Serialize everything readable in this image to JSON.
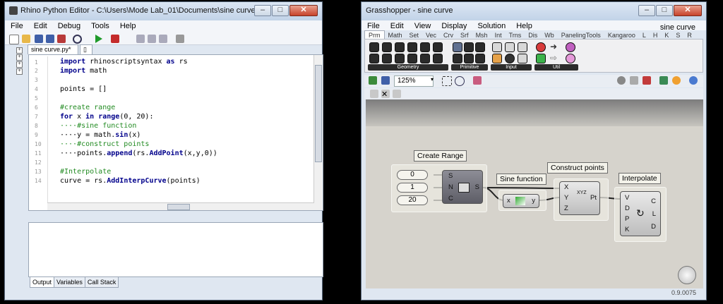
{
  "rhino": {
    "title": "Rhino Python Editor - C:\\Users\\Mode Lab_01\\Documents\\sine curve.py",
    "menu": [
      "File",
      "Edit",
      "Debug",
      "Tools",
      "Help"
    ],
    "tab": "sine curve.py*",
    "line_numbers": [
      "1",
      "2",
      "3",
      "4",
      "5",
      "6",
      "7",
      "8",
      "9",
      "10",
      "11",
      "12",
      "13",
      "14"
    ],
    "code": {
      "l1_kw": "import",
      "l1_rest": " rhinoscriptsyntax ",
      "l1_kw2": "as",
      "l1_rest2": " rs",
      "l2_kw": "import",
      "l2_rest": " math",
      "l4": "points = []",
      "l6": "#create range",
      "l7_kw": "for",
      "l7_a": " x ",
      "l7_kw2": "in",
      "l7_b": " ",
      "l7_kw3": "range",
      "l7_c": "(0, 20):",
      "l8": "····#sine function",
      "l9_a": "····y = math.",
      "l9_kw": "sin",
      "l9_b": "(x)",
      "l10": "····#construct points",
      "l11_a": "····points.",
      "l11_kw": "append",
      "l11_b": "(rs.",
      "l11_kw2": "AddPoint",
      "l11_c": "(x,y,0))",
      "l13": "#Interpolate",
      "l14_a": "curve = rs.",
      "l14_kw": "AddInterpCurve",
      "l14_b": "(points)"
    },
    "bottom_tabs": [
      "Output",
      "Variables",
      "Call Stack"
    ]
  },
  "gh": {
    "title": "Grasshopper - sine curve",
    "menu": [
      "File",
      "Edit",
      "View",
      "Display",
      "Solution",
      "Help"
    ],
    "doc_name": "sine curve",
    "tabs": [
      "Prm",
      "Math",
      "Set",
      "Vec",
      "Crv",
      "Srf",
      "Msh",
      "Int",
      "Trns",
      "Dis",
      "Wb",
      "PanelingTools",
      "Kangaroo",
      "L",
      "H",
      "K",
      "S",
      "R"
    ],
    "groups": [
      "Geometry",
      "Primitive",
      "Input",
      "Util"
    ],
    "zoom": "125%",
    "version": "0.9.0075",
    "canvas": {
      "create_range": "Create Range",
      "inputs": [
        "0",
        "1",
        "20"
      ],
      "range_pins_in": [
        "S",
        "N",
        "C"
      ],
      "range_pin_out": "S",
      "sine_function": "Sine function",
      "sine_x": "x",
      "sine_y": "y",
      "construct_points": "Construct points",
      "cp_in": [
        "X",
        "Y",
        "Z"
      ],
      "cp_out": "Pt",
      "cp_glyph": "XYZ",
      "interpolate": "Interpolate",
      "ip_in": [
        "V",
        "D",
        "P",
        "K"
      ],
      "ip_out": [
        "C",
        "L",
        "D"
      ]
    }
  }
}
